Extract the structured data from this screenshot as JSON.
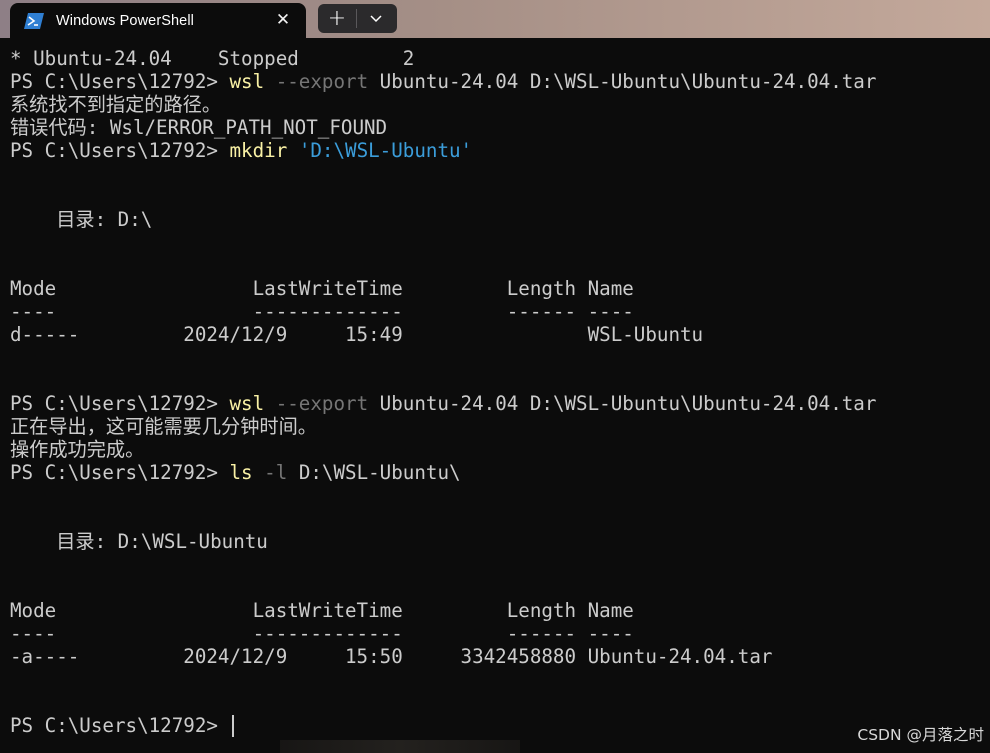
{
  "tab": {
    "title": "Windows PowerShell",
    "close_glyph": "✕",
    "new_tab_glyph": "+",
    "dropdown_glyph": "⌄"
  },
  "terminal": {
    "lines": [
      [
        {
          "t": "* Ubuntu-24.04    Stopped         2",
          "c": ""
        }
      ],
      [
        {
          "t": "PS C:\\Users\\12792> ",
          "c": ""
        },
        {
          "t": "wsl",
          "c": "cmd"
        },
        {
          "t": " --export",
          "c": "param"
        },
        {
          "t": " Ubuntu-24.04 D:\\WSL-Ubuntu\\Ubuntu-24.04.tar",
          "c": ""
        }
      ],
      [
        {
          "t": "系统找不到指定的路径。",
          "c": ""
        }
      ],
      [
        {
          "t": "错误代码: Wsl/ERROR_PATH_NOT_FOUND",
          "c": ""
        }
      ],
      [
        {
          "t": "PS C:\\Users\\12792> ",
          "c": ""
        },
        {
          "t": "mkdir",
          "c": "cmd"
        },
        {
          "t": " 'D:\\WSL-Ubuntu'",
          "c": "str"
        }
      ],
      [],
      [],
      [
        {
          "t": "    目录: D:\\",
          "c": ""
        }
      ],
      [],
      [],
      [
        {
          "t": "Mode                 LastWriteTime         Length Name",
          "c": ""
        }
      ],
      [
        {
          "t": "----                 -------------         ------ ----",
          "c": ""
        }
      ],
      [
        {
          "t": "d-----         2024/12/9     15:49                WSL-Ubuntu",
          "c": ""
        }
      ],
      [],
      [],
      [
        {
          "t": "PS C:\\Users\\12792> ",
          "c": ""
        },
        {
          "t": "wsl",
          "c": "cmd"
        },
        {
          "t": " --export",
          "c": "param"
        },
        {
          "t": " Ubuntu-24.04 D:\\WSL-Ubuntu\\Ubuntu-24.04.tar",
          "c": ""
        }
      ],
      [
        {
          "t": "正在导出，这可能需要几分钟时间。",
          "c": ""
        }
      ],
      [
        {
          "t": "操作成功完成。",
          "c": ""
        }
      ],
      [
        {
          "t": "PS C:\\Users\\12792> ",
          "c": ""
        },
        {
          "t": "ls",
          "c": "cmd"
        },
        {
          "t": " -l",
          "c": "param"
        },
        {
          "t": " D:\\WSL-Ubuntu\\",
          "c": ""
        }
      ],
      [],
      [],
      [
        {
          "t": "    目录: D:\\WSL-Ubuntu",
          "c": ""
        }
      ],
      [],
      [],
      [
        {
          "t": "Mode                 LastWriteTime         Length Name",
          "c": ""
        }
      ],
      [
        {
          "t": "----                 -------------         ------ ----",
          "c": ""
        }
      ],
      [
        {
          "t": "-a----         2024/12/9     15:50     3342458880 Ubuntu-24.04.tar",
          "c": ""
        }
      ],
      [],
      [],
      [
        {
          "t": "PS C:\\Users\\12792> ",
          "c": ""
        }
      ]
    ]
  },
  "watermark": "CSDN @月落之时",
  "colors": {
    "background": "#0c0c0c",
    "text": "#cccccc",
    "command": "#f9f1a5",
    "parameter": "#767676",
    "string": "#3b9dda"
  }
}
